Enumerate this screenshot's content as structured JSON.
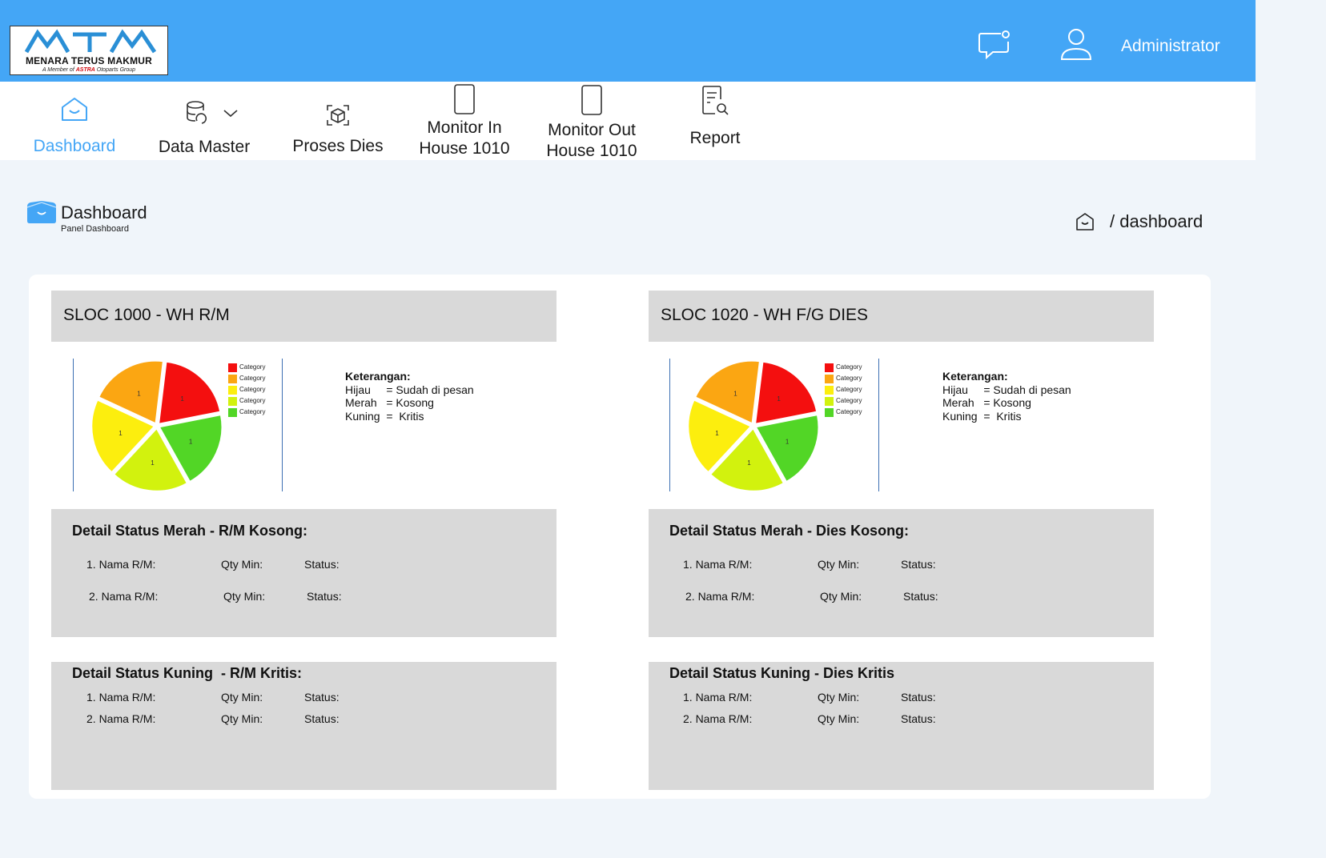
{
  "header": {
    "logo": {
      "name": "MENARA TERUS MAKMUR",
      "tagline_prefix": "A Member of ",
      "tagline_brand": "ASTRA",
      "tagline_suffix": " Otoparts Group",
      "mark": "MTM"
    },
    "user_name": "Administrator",
    "icons": {
      "chat": "chat-icon",
      "user": "user-icon"
    },
    "colors": {
      "bar": "#44a6f6"
    }
  },
  "nav": {
    "items": [
      {
        "label": "Dashboard",
        "icon": "home-icon",
        "active": true
      },
      {
        "label": "Data Master",
        "icon": "database-icon"
      },
      {
        "label": "Proses Dies",
        "icon": "box-icon"
      },
      {
        "label": "Monitor In\nHouse 1010",
        "icon": "phone-icon"
      },
      {
        "label": "Monitor Out\nHouse 1010",
        "icon": "phone-icon"
      },
      {
        "label": "Report",
        "icon": "report-search-icon"
      }
    ]
  },
  "page": {
    "title": "Dashboard",
    "subtitle": "Panel Dashboard",
    "breadcrumb": "/ dashboard"
  },
  "sections": [
    {
      "title": "SLOC 1000 - WH R/M",
      "chart_data": {
        "type": "pie",
        "categories": [
          "Category",
          "Category",
          "Category",
          "Category",
          "Category"
        ],
        "values": [
          1,
          1,
          1,
          1,
          1
        ],
        "colors": [
          "#f40f0f",
          "#fba612",
          "#fcee0e",
          "#d2f20e",
          "#52d626"
        ],
        "legend": "right"
      },
      "keterangan": {
        "title": "Keterangan:",
        "rows": [
          "Hijau     = Sudah di pesan",
          "Merah   = Kosong",
          "Kuning  =  Kritis"
        ]
      },
      "detail_merah": {
        "title": "Detail Status Merah - R/M Kosong:",
        "rows": [
          [
            "1. Nama R/M:",
            "Qty Min:",
            "Status:"
          ],
          [
            "2. Nama R/M:",
            "Qty Min:",
            "Status:"
          ]
        ]
      },
      "detail_kuning": {
        "title": "Detail Status Kuning  - R/M Kritis:",
        "rows": [
          [
            "1. Nama R/M:",
            "Qty Min:",
            "Status:"
          ],
          [
            "2. Nama R/M:",
            "Qty Min:",
            "Status:"
          ]
        ]
      }
    },
    {
      "title": "SLOC 1020 - WH F/G DIES",
      "chart_data": {
        "type": "pie",
        "categories": [
          "Category",
          "Category",
          "Category",
          "Category",
          "Category"
        ],
        "values": [
          1,
          1,
          1,
          1,
          1
        ],
        "colors": [
          "#f40f0f",
          "#fba612",
          "#fcee0e",
          "#d2f20e",
          "#52d626"
        ],
        "legend": "right"
      },
      "keterangan": {
        "title": "Keterangan:",
        "rows": [
          "Hijau     = Sudah di pesan",
          "Merah   = Kosong",
          "Kuning  =  Kritis"
        ]
      },
      "detail_merah": {
        "title": "Detail Status Merah - Dies Kosong:",
        "rows": [
          [
            "1. Nama R/M:",
            "Qty Min:",
            "Status:"
          ],
          [
            "2. Nama R/M:",
            "Qty Min:",
            "Status:"
          ]
        ]
      },
      "detail_kuning": {
        "title": "Detail Status Kuning - Dies Kritis",
        "rows": [
          [
            "1. Nama R/M:",
            "Qty Min:",
            "Status:"
          ],
          [
            "2. Nama R/M:",
            "Qty Min:",
            "Status:"
          ]
        ]
      }
    }
  ]
}
